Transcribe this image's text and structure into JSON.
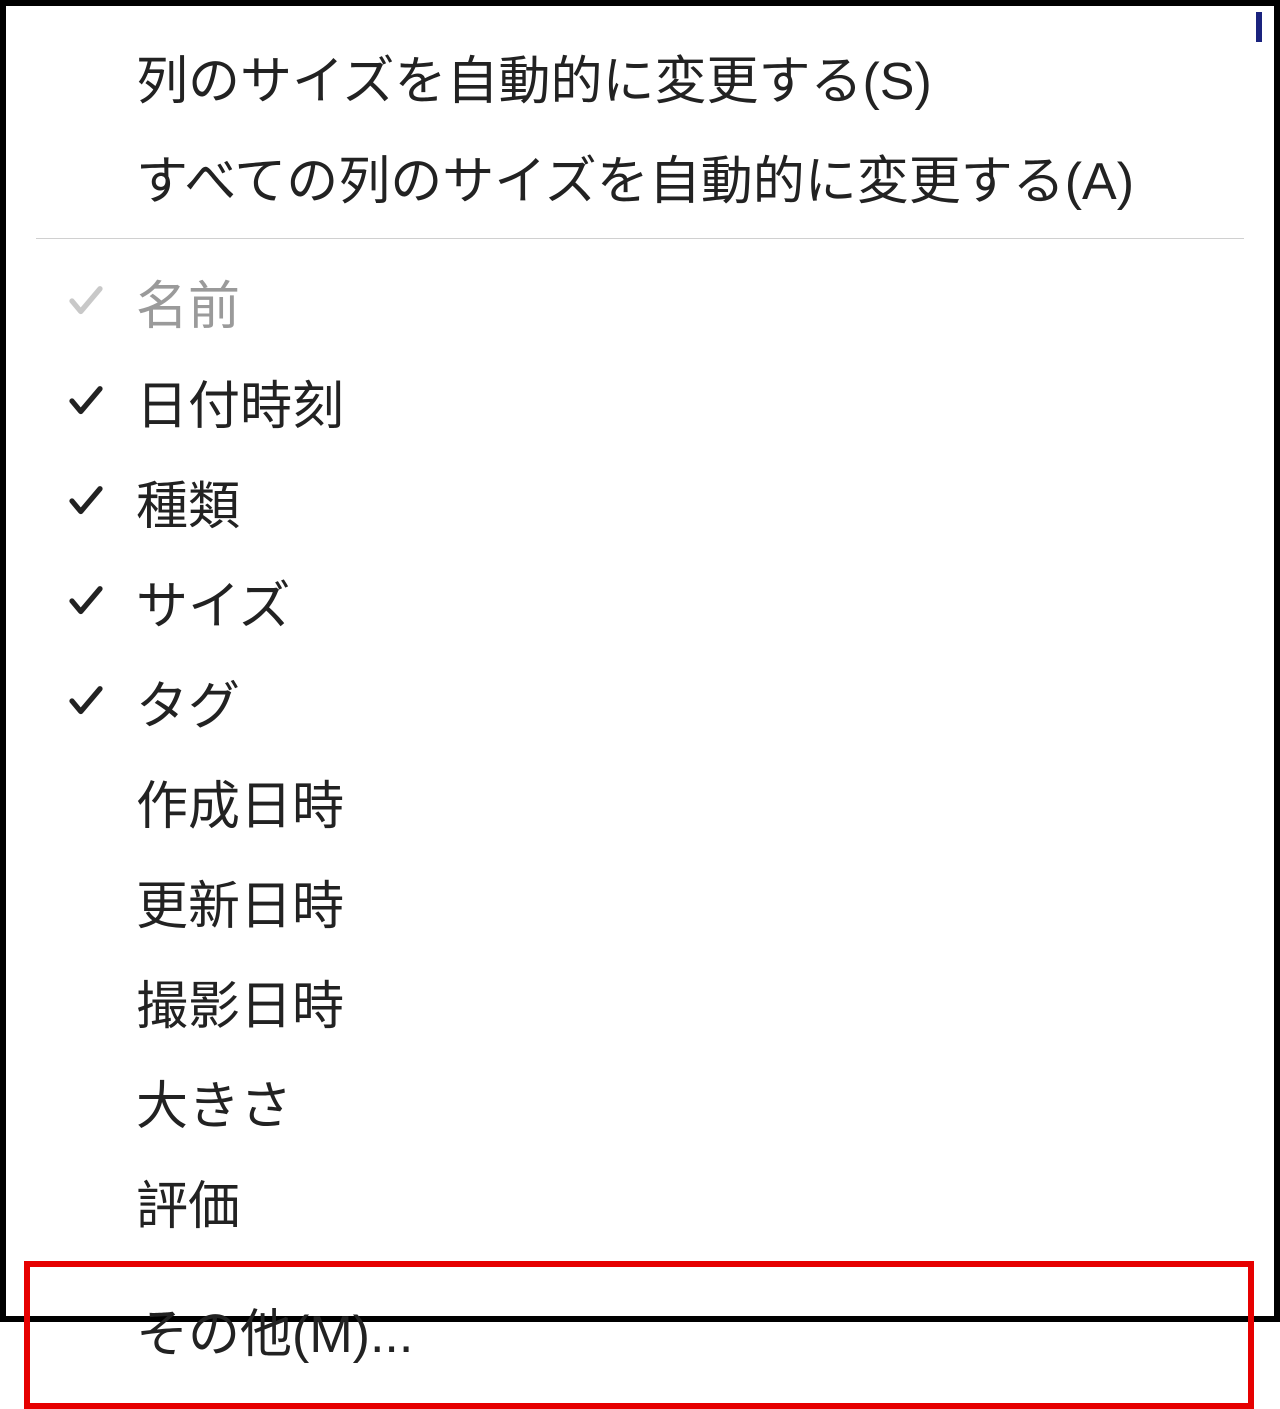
{
  "menu": {
    "actions": [
      {
        "label": "列のサイズを自動的に変更する(S)"
      },
      {
        "label": "すべての列のサイズを自動的に変更する(A)"
      }
    ],
    "columns": [
      {
        "label": "名前",
        "checked": true,
        "disabled": true
      },
      {
        "label": "日付時刻",
        "checked": true,
        "disabled": false
      },
      {
        "label": "種類",
        "checked": true,
        "disabled": false
      },
      {
        "label": "サイズ",
        "checked": true,
        "disabled": false
      },
      {
        "label": "タグ",
        "checked": true,
        "disabled": false
      },
      {
        "label": "作成日時",
        "checked": false,
        "disabled": false
      },
      {
        "label": "更新日時",
        "checked": false,
        "disabled": false
      },
      {
        "label": "撮影日時",
        "checked": false,
        "disabled": false
      },
      {
        "label": "大きさ",
        "checked": false,
        "disabled": false
      },
      {
        "label": "評価",
        "checked": false,
        "disabled": false
      }
    ],
    "more": {
      "label": "その他(M)..."
    }
  },
  "highlight": {
    "target": "more-item"
  }
}
